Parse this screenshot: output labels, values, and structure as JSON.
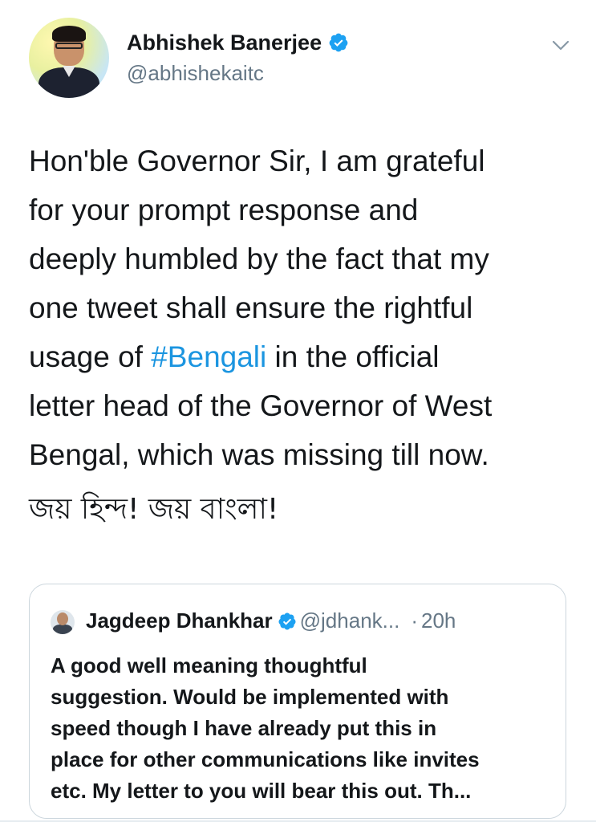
{
  "tweet": {
    "author": {
      "name": "Abhishek Banerjee",
      "handle": "@abhishekaitc",
      "verified": true
    },
    "text_lines": [
      "Hon'ble Governor Sir, I am grateful",
      "for your prompt response and",
      "deeply humbled by the fact that my",
      "one tweet shall ensure the rightful",
      "usage of ",
      "#Bengali",
      " in the official",
      "letter head of the Governor of West",
      "Bengal, which was missing till now."
    ],
    "bengali_line": "জয় হিন্দ! জয় বাংলা!"
  },
  "quoted": {
    "author": {
      "name": "Jagdeep Dhankhar",
      "handle": "@jdhank...",
      "verified": true
    },
    "separator": "·",
    "time": "20h",
    "text_lines": [
      "A good well meaning thoughtful",
      "suggestion. Would be implemented with",
      "speed though I  have already put this in",
      "place for other communications like invites",
      "etc. My letter to you will bear this out. Th..."
    ]
  },
  "icons": {
    "verified": "verified-badge-icon",
    "menu": "chevron-down-icon"
  },
  "colors": {
    "verified_blue": "#1da1f2",
    "hashtag_blue": "#1b95e0",
    "secondary_text": "#657786",
    "border": "#ccd6dd"
  }
}
